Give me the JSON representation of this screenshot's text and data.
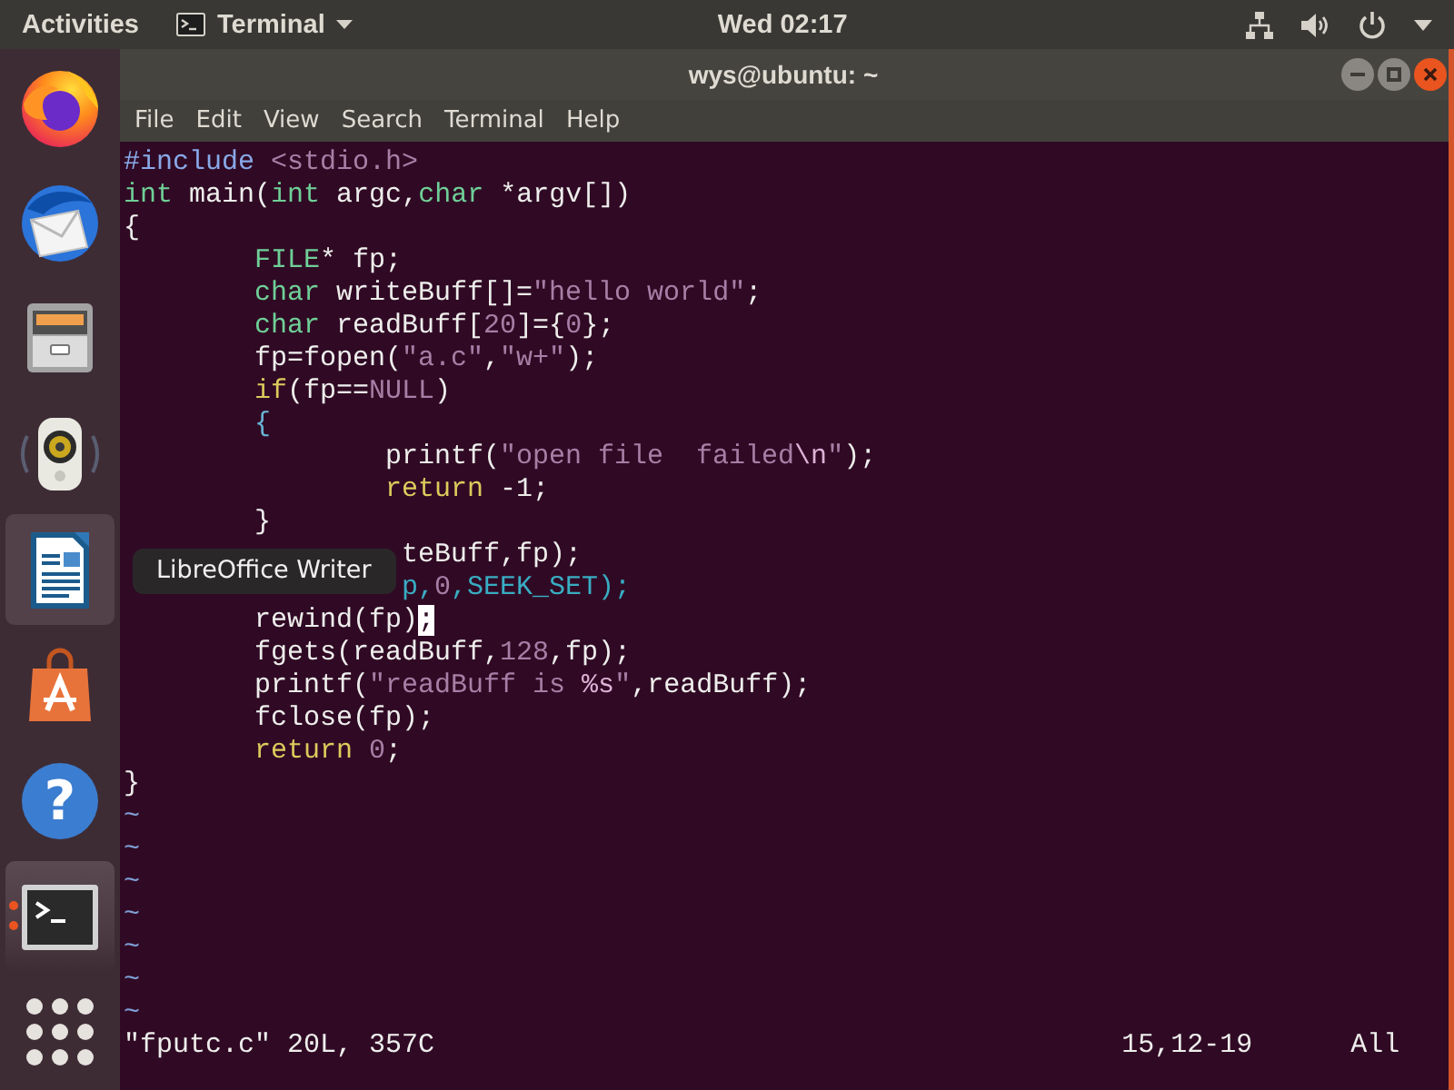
{
  "top_bar": {
    "activities": "Activities",
    "app_menu": {
      "label": "Terminal"
    },
    "clock": "Wed 02:17"
  },
  "dock": {
    "items": [
      {
        "hovered": false,
        "running": false
      },
      {
        "hovered": false,
        "running": false
      },
      {
        "hovered": false,
        "running": false
      },
      {
        "hovered": false,
        "running": false
      },
      {
        "hovered": true,
        "running": false
      },
      {
        "hovered": false,
        "running": false
      },
      {
        "hovered": false,
        "running": false,
        "glyph": "?"
      },
      {
        "hovered": false,
        "running": true
      },
      {
        "hovered": false,
        "running": false
      }
    ],
    "tooltip": "LibreOffice Writer"
  },
  "window": {
    "title": "wys@ubuntu: ~",
    "menu": [
      "File",
      "Edit",
      "View",
      "Search",
      "Terminal",
      "Help"
    ]
  },
  "editor": {
    "lines": [
      {
        "covered": false,
        "tokens": [
          {
            "kind": "preproc",
            "text": "#include "
          },
          {
            "kind": "string",
            "text": "<stdio.h>"
          }
        ]
      },
      {
        "covered": false,
        "tokens": [
          {
            "kind": "type",
            "text": "int"
          },
          {
            "kind": "plain",
            "text": " main("
          },
          {
            "kind": "type",
            "text": "int"
          },
          {
            "kind": "plain",
            "text": " argc,"
          },
          {
            "kind": "type",
            "text": "char"
          },
          {
            "kind": "plain",
            "text": " *argv[])"
          }
        ]
      },
      {
        "covered": false,
        "tokens": [
          {
            "kind": "plain",
            "text": "{"
          }
        ],
        "children": [
          {
            "covered": false,
            "tokens": [
              {
                "kind": "type",
                "text": "FILE"
              },
              {
                "kind": "plain",
                "text": "* fp;"
              }
            ]
          },
          {
            "covered": false,
            "tokens": [
              {
                "kind": "type",
                "text": "char"
              },
              {
                "kind": "plain",
                "text": " writeBuff[]="
              },
              {
                "kind": "string",
                "text": "\"hello world\""
              },
              {
                "kind": "plain",
                "text": ";"
              }
            ]
          },
          {
            "covered": false,
            "tokens": [
              {
                "kind": "type",
                "text": "char"
              },
              {
                "kind": "plain",
                "text": " readBuff["
              },
              {
                "kind": "number",
                "text": "20"
              },
              {
                "kind": "plain",
                "text": "]={"
              },
              {
                "kind": "number",
                "text": "0"
              },
              {
                "kind": "plain",
                "text": "};"
              }
            ]
          },
          {
            "covered": false,
            "tokens": [
              {
                "kind": "plain",
                "text": "fp=fopen("
              },
              {
                "kind": "string",
                "text": "\"a.c\""
              },
              {
                "kind": "plain",
                "text": ","
              },
              {
                "kind": "string",
                "text": "\"w+\""
              },
              {
                "kind": "plain",
                "text": ");"
              }
            ]
          },
          {
            "covered": false,
            "tokens": [
              {
                "kind": "keyword",
                "text": "if"
              },
              {
                "kind": "plain",
                "text": "(fp=="
              },
              {
                "kind": "number",
                "text": "NULL"
              },
              {
                "kind": "plain",
                "text": ")"
              }
            ]
          },
          {
            "covered": false,
            "tokens": [
              {
                "kind": "delimiter",
                "text": "{"
              }
            ],
            "children": [
              {
                "covered": false,
                "tokens": [
                  {
                    "kind": "plain",
                    "text": "printf("
                  },
                  {
                    "kind": "string",
                    "text": "\"open file  failed"
                  },
                  {
                    "kind": "special",
                    "text": "\\n"
                  },
                  {
                    "kind": "string",
                    "text": "\""
                  },
                  {
                    "kind": "plain",
                    "text": ");"
                  }
                ]
              },
              {
                "covered": false,
                "tokens": [
                  {
                    "kind": "keyword",
                    "text": "return"
                  },
                  {
                    "kind": "plain",
                    "text": " -1;"
                  }
                ]
              }
            ]
          },
          {
            "covered": false,
            "tokens": [
              {
                "kind": "plain",
                "text": "}"
              }
            ]
          },
          {
            "covered": true,
            "tokens": [
              {
                "kind": "plain",
                "text": "teBuff,fp);"
              }
            ]
          },
          {
            "covered": true,
            "tokens": [
              {
                "kind": "comment",
                "text": "p,"
              },
              {
                "kind": "number",
                "text": "0"
              },
              {
                "kind": "comment",
                "text": ",SEEK_SET);"
              }
            ]
          },
          {
            "covered": false,
            "tokens": [
              {
                "kind": "plain",
                "text": "rewind(fp)"
              },
              {
                "kind": "cursor",
                "text": ";"
              }
            ]
          },
          {
            "covered": false,
            "tokens": [
              {
                "kind": "plain",
                "text": "fgets(readBuff,"
              },
              {
                "kind": "number",
                "text": "128"
              },
              {
                "kind": "plain",
                "text": ",fp);"
              }
            ]
          },
          {
            "covered": false,
            "tokens": [
              {
                "kind": "plain",
                "text": "printf("
              },
              {
                "kind": "string",
                "text": "\"readBuff is "
              },
              {
                "kind": "special",
                "text": "%s"
              },
              {
                "kind": "string",
                "text": "\""
              },
              {
                "kind": "plain",
                "text": ",readBuff);"
              }
            ]
          },
          {
            "covered": false,
            "tokens": [
              {
                "kind": "plain",
                "text": "fclose(fp);"
              }
            ]
          },
          {
            "covered": false,
            "tokens": [
              {
                "kind": "keyword",
                "text": "return "
              },
              {
                "kind": "number",
                "text": "0"
              },
              {
                "kind": "plain",
                "text": ";"
              }
            ]
          }
        ]
      },
      {
        "covered": false,
        "tokens": [
          {
            "kind": "plain",
            "text": "}"
          }
        ]
      }
    ],
    "empty_line_markers": [
      "~",
      "~",
      "~",
      "~",
      "~",
      "~",
      "~"
    ],
    "status_line": {
      "message": "\"fputc.c\" 20L, 357C",
      "position": "15,12-19",
      "scroll": "All"
    }
  }
}
